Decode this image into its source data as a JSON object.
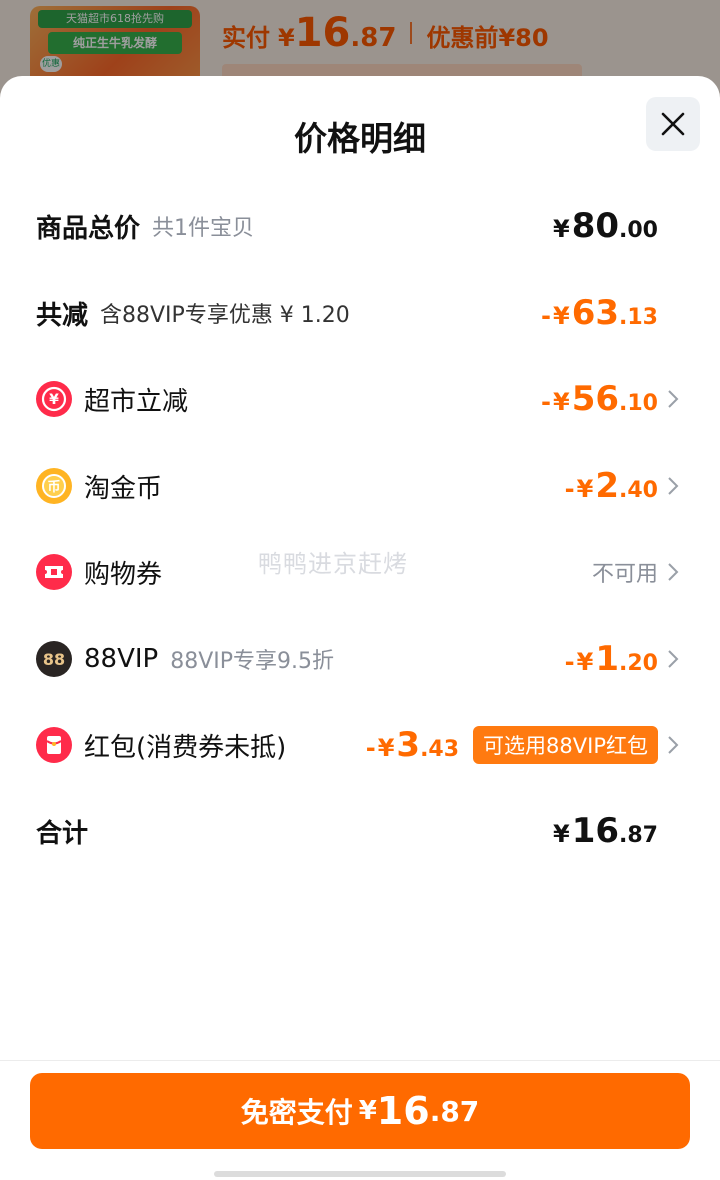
{
  "background": {
    "thumb_top": "天猫超市618抢先购",
    "thumb_mid": "纯正生牛乳发酵",
    "thumb_tag": "优惠",
    "paid_label": "实付",
    "currency": "¥",
    "paid_int": "16",
    "paid_dec": ".87",
    "orig_label": "优惠前",
    "orig_price": "¥80"
  },
  "sheet": {
    "title": "价格明细",
    "close_icon": "close-icon"
  },
  "rows": {
    "total": {
      "label": "商品总价",
      "sub": "共1件宝贝",
      "cur": "¥",
      "int": "80",
      "dec": ".00"
    },
    "reduction": {
      "label": "共减",
      "sub": "含88VIP专享优惠 ¥ 1.20",
      "minus": "-",
      "cur": "¥",
      "int": "63",
      "dec": ".13"
    },
    "supermarket": {
      "icon": "yen-coupon-icon",
      "label": "超市立减",
      "minus": "-",
      "cur": "¥",
      "int": "56",
      "dec": ".10"
    },
    "taojinbi": {
      "icon": "gold-coin-icon",
      "label": "淘金币",
      "minus": "-",
      "cur": "¥",
      "int": "2",
      "dec": ".40"
    },
    "coupon": {
      "icon": "ticket-icon",
      "label": "购物券",
      "status": "不可用"
    },
    "vip88": {
      "icon": "88vip-badge-icon",
      "badge": "88",
      "label": "88VIP",
      "sub": "88VIP专享9.5折",
      "minus": "-",
      "cur": "¥",
      "int": "1",
      "dec": ".20"
    },
    "redpacket": {
      "icon": "red-packet-icon",
      "label": "红包(消费券未抵)",
      "minus": "-",
      "cur": "¥",
      "int": "3",
      "dec": ".43",
      "tag": "可选用88VIP红包"
    },
    "sum": {
      "label": "合计",
      "cur": "¥",
      "int": "16",
      "dec": ".87"
    }
  },
  "watermark": "鸭鸭进京赶烤",
  "footer": {
    "pay_label": "免密支付",
    "cur": "¥",
    "int": "16",
    "dec": ".87"
  },
  "colors": {
    "accent": "#ff6a00",
    "muted": "#8a8f99",
    "text": "#111111"
  }
}
